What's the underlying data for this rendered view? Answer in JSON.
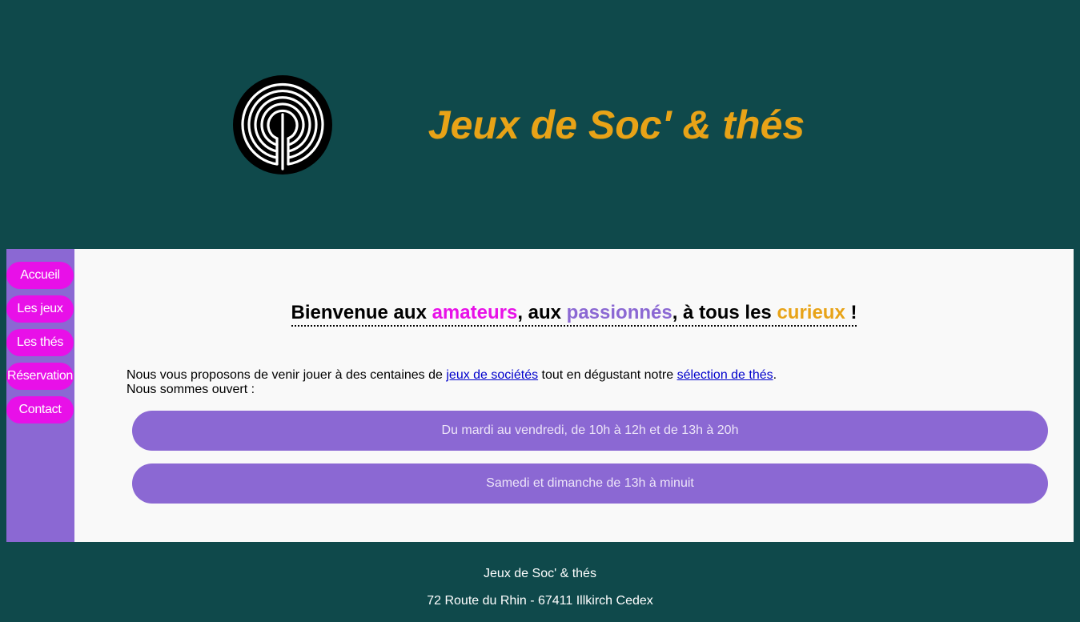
{
  "header": {
    "title": "Jeux de Soc' & thés",
    "logo_icon": "labyrinth-logo-icon"
  },
  "nav": {
    "items": [
      {
        "label": "Accueil"
      },
      {
        "label": "Les jeux"
      },
      {
        "label": "Les thés"
      },
      {
        "label": "Réservation"
      },
      {
        "label": "Contact"
      }
    ]
  },
  "welcome": {
    "part1": "Bienvenue aux ",
    "word1": "amateurs",
    "part2": ", aux ",
    "word2": "passionnés",
    "part3": ", à tous les ",
    "word3": "curieux",
    "part4": " !"
  },
  "intro": {
    "text1": "Nous vous proposons de venir jouer à des centaines de ",
    "link1": "jeux de sociétés",
    "text2": " tout en dégustant notre ",
    "link2": "sélection de thés",
    "text3": ".",
    "line2": "Nous sommes ouvert :"
  },
  "hours": [
    "Du mardi au vendredi, de 10h à 12h et de 13h à 20h",
    "Samedi et dimanche de 13h à minuit"
  ],
  "footer": {
    "name": "Jeux de Soc' & thés",
    "address": "72 Route du Rhin - 67411 Illkirch Cedex"
  },
  "colors": {
    "background": "#0f494b",
    "title": "#e8a317",
    "nav_button": "#e810e8",
    "sidebar": "#8b68d3",
    "content_bg": "#f9f9f9",
    "hours_bg": "#8b68d3"
  }
}
